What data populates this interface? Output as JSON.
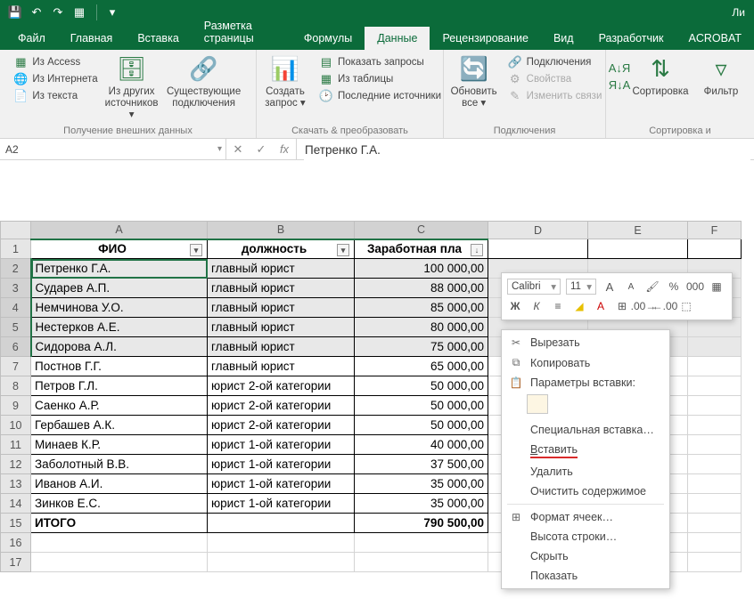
{
  "qat": {
    "save": "💾",
    "undo": "↶",
    "redo": "↷",
    "customize": "▦"
  },
  "title_right": "Ли",
  "tabs": {
    "file": "Файл",
    "home": "Главная",
    "insert": "Вставка",
    "pagelayout": "Разметка страницы",
    "formulas": "Формулы",
    "data": "Данные",
    "review": "Рецензирование",
    "view": "Вид",
    "developer": "Разработчик",
    "acrobat": "ACROBAT"
  },
  "ribbon": {
    "ext": {
      "access": "Из Access",
      "web": "Из Интернета",
      "text": "Из текста",
      "other": "Из других источников ▾",
      "existing": "Существующие подключения",
      "group": "Получение внешних данных"
    },
    "get": {
      "new": "Создать запрос ▾",
      "show": "Показать запросы",
      "table": "Из таблицы",
      "recent": "Последние источники",
      "group": "Скачать & преобразовать"
    },
    "conn": {
      "refresh": "Обновить все ▾",
      "connections": "Подключения",
      "properties": "Свойства",
      "editlinks": "Изменить связи",
      "group": "Подключения"
    },
    "sort": {
      "az": "А↓Я",
      "za": "Я↓А",
      "sort": "Сортировка",
      "filter": "Фильтр",
      "group": "Сортировка и"
    }
  },
  "namebox": "A2",
  "fx_value": "Петренко Г.А.",
  "columns": [
    "A",
    "B",
    "C",
    "D",
    "E",
    "F"
  ],
  "headers": {
    "a": "ФИО",
    "b": "должность",
    "c": "Заработная пла"
  },
  "rows": [
    {
      "n": 2,
      "a": "Петренко Г.А.",
      "b": "главный юрист",
      "c": "100 000,00",
      "sel": true
    },
    {
      "n": 3,
      "a": "Сударев А.П.",
      "b": "главный юрист",
      "c": "88 000,00",
      "sel": true
    },
    {
      "n": 4,
      "a": "Немчинова У.О.",
      "b": "главный юрист",
      "c": "85 000,00",
      "sel": true
    },
    {
      "n": 5,
      "a": "Нестерков А.Е.",
      "b": "главный юрист",
      "c": "80 000,00",
      "sel": true
    },
    {
      "n": 6,
      "a": "Сидорова А.Л.",
      "b": "главный юрист",
      "c": "75 000,00",
      "sel": true
    },
    {
      "n": 7,
      "a": "Постнов Г.Г.",
      "b": "главный юрист",
      "c": "65 000,00"
    },
    {
      "n": 8,
      "a": "Петров Г.Л.",
      "b": "юрист 2-ой категории",
      "c": "50 000,00"
    },
    {
      "n": 9,
      "a": "Саенко А.Р.",
      "b": "юрист 2-ой категории",
      "c": "50 000,00"
    },
    {
      "n": 10,
      "a": "Гербашев А.К.",
      "b": "юрист 2-ой категории",
      "c": "50 000,00"
    },
    {
      "n": 11,
      "a": "Минаев К.Р.",
      "b": "юрист 1-ой категории",
      "c": "40 000,00"
    },
    {
      "n": 12,
      "a": "Заболотный В.В.",
      "b": "юрист 1-ой категории",
      "c": "37 500,00"
    },
    {
      "n": 13,
      "a": "Иванов А.И.",
      "b": "юрист 1-ой категории",
      "c": "35 000,00"
    },
    {
      "n": 14,
      "a": "Зинков Е.С.",
      "b": "юрист 1-ой категории",
      "c": "35 000,00"
    }
  ],
  "total": {
    "n": 15,
    "label": "ИТОГО",
    "value": "790 500,00"
  },
  "emptyrows": [
    16,
    17
  ],
  "mini": {
    "font": "Calibri",
    "size": "11",
    "grow": "A",
    "shrink": "A",
    "pct": "%",
    "sep": "000",
    "bold": "Ж",
    "italic": "К"
  },
  "ctx": {
    "cut": "Вырезать",
    "copy": "Копировать",
    "pasteopt": "Параметры вставки:",
    "pastespecial": "Специальная вставка…",
    "insert": "Вставить",
    "delete": "Удалить",
    "clear": "Очистить содержимое",
    "format": "Формат ячеек…",
    "rowheight": "Высота строки…",
    "hide": "Скрыть",
    "show": "Показать"
  }
}
